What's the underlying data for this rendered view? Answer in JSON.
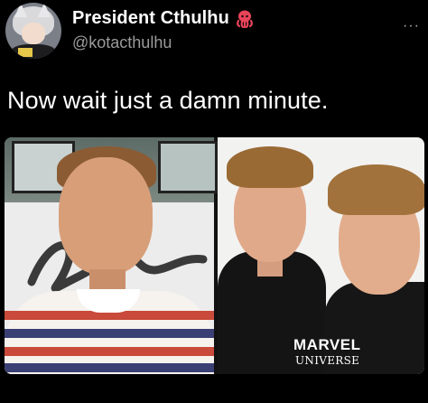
{
  "tweet": {
    "author_name": "President Cthulhu",
    "author_handle": "@kotacthulhu",
    "text": "Now wait just a damn minute.",
    "name_emoji": "octopus-icon",
    "more_label": "···"
  },
  "media": {
    "left_panel": "boy-in-striped-shirt-photo",
    "right_panel": "man-in-black-shirt-photos",
    "watermark_line1": "MARVEL",
    "watermark_line2": "UNIVERSE"
  },
  "colors": {
    "background": "#000000",
    "text_primary": "#ffffff",
    "text_secondary": "#9a9a9a",
    "octopus": "#e8445a"
  }
}
